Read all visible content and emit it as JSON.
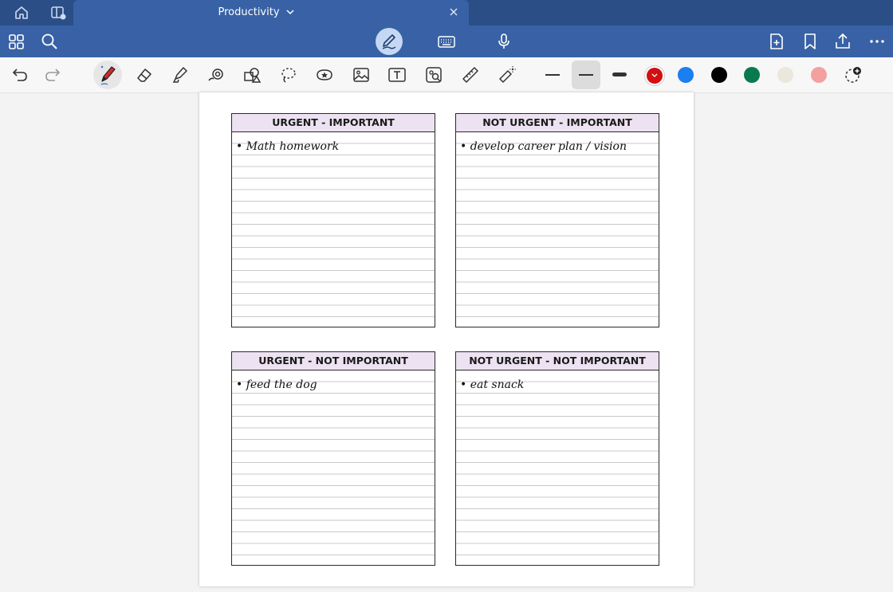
{
  "titlebar": {
    "doc_title": "Productivity",
    "icons": [
      "home-icon",
      "tabs-icon",
      "chevron-down-icon",
      "close-icon"
    ]
  },
  "toolbar": {
    "icons": [
      "grid-icon",
      "search-icon",
      "pen-mode-icon",
      "keyboard-icon",
      "microphone-icon",
      "add-page-icon",
      "bookmark-icon",
      "share-icon",
      "more-icon"
    ]
  },
  "tools": {
    "items": [
      "undo-icon",
      "redo-icon",
      "pen-icon",
      "eraser-icon",
      "highlighter-icon",
      "shapes-icon",
      "elements-icon",
      "lasso-icon",
      "sticker-icon",
      "image-icon",
      "text-icon",
      "scan-icon",
      "ruler-icon",
      "laser-pointer-icon"
    ],
    "active_tool": "pen",
    "colors": [
      "#d40f12",
      "#1a7ff0",
      "#000000",
      "#0a7a4e",
      "#ebe7dc",
      "#f4a0a0"
    ],
    "selected_color": "#d40f12"
  },
  "matrix": {
    "quadrants": [
      {
        "title": "URGENT - IMPORTANT",
        "note": "• Math homework"
      },
      {
        "title": "NOT URGENT - IMPORTANT",
        "note": "• develop career plan / vision"
      },
      {
        "title": "URGENT - NOT IMPORTANT",
        "note": "• feed the dog"
      },
      {
        "title": "NOT URGENT - NOT IMPORTANT",
        "note": "• eat snack"
      }
    ]
  }
}
